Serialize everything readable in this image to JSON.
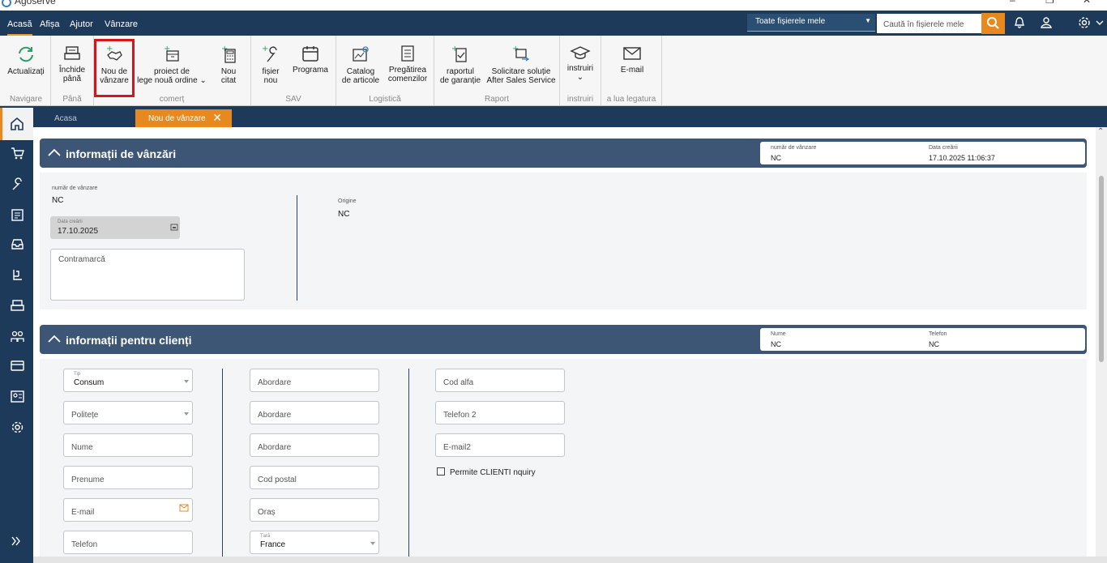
{
  "app": {
    "title": "Agoserve"
  },
  "menu": {
    "items": [
      "Acasă",
      "Afișa",
      "Ajutor",
      "Vânzare"
    ]
  },
  "header": {
    "file_selector": "Toate fișierele mele",
    "search_placeholder": "Caută în fișierele mele"
  },
  "ribbon": {
    "buttons": {
      "refresh": "Actualizați",
      "close_until_1": "Închide",
      "close_until_2": "până",
      "new_sale_1": "Nou de",
      "new_sale_2": "vânzare",
      "project_1": "proiect de",
      "project_2": "lege nouă ordine",
      "new_quote_1": "Nou",
      "new_quote_2": "citat",
      "file_1": "fișier",
      "file_2": "nou",
      "program": "Programa",
      "catalog_1": "Catalog",
      "catalog_2": "de articole",
      "prep_1": "Pregătirea",
      "prep_2": "comenzilor",
      "warranty_1": "raportul",
      "warranty_2": "de garanție",
      "solicit_1": "Solicitare soluție",
      "solicit_2": "After Sales Service",
      "training": "instruiri",
      "email": "E-mail"
    },
    "groups": {
      "nav": "Navigare",
      "until": "Până",
      "commerce": "comerț",
      "sav": "SAV",
      "logistics": "Logistică",
      "report": "Raport",
      "training": "instruiri",
      "contact": "a lua legatura"
    }
  },
  "tabs": {
    "home": "Acasa",
    "new_sale": "Nou de vânzare"
  },
  "sales_info": {
    "title": "informații de vânzări",
    "summary_number_label": "număr de vânzare",
    "summary_number_value": "NC",
    "summary_date_label": "Data creării",
    "summary_date_value": "17.10.2025 11:06:37",
    "number_label": "număr de vânzare",
    "number_value": "NC",
    "date_label": "Data creării",
    "date_value": "17.10.2025",
    "counter_placeholder": "Contramarcă",
    "origin_label": "Origine",
    "origin_value": "NC"
  },
  "client_info": {
    "title": "informații pentru clienți",
    "summary_name_label": "Nume",
    "summary_name_value": "NC",
    "summary_phone_label": "Telefon",
    "summary_phone_value": "NC",
    "type_label": "Tip",
    "type_value": "Consum",
    "politeness": "Politețe",
    "name": "Nume",
    "firstname": "Prenume",
    "email": "E-mail",
    "phone": "Telefon",
    "address1": "Abordare",
    "address2": "Abordare",
    "address3": "Abordare",
    "postal": "Cod postal",
    "city": "Oraș",
    "country_label": "Țară",
    "country_value": "France",
    "alpha": "Cod alfa",
    "phone2": "Telefon 2",
    "email2": "E-mail2",
    "allow_inquiry": "Permite CLIENTI nquiry"
  }
}
